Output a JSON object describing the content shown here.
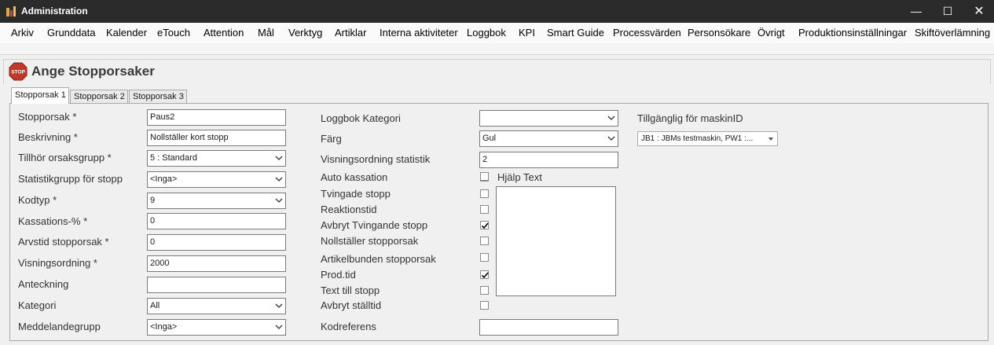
{
  "window": {
    "title": "Administration",
    "minimize": "—",
    "maximize": "☐",
    "close": "✕"
  },
  "menu": [
    "Arkiv",
    "Grunddata",
    "Kalender",
    "eTouch",
    "Attention",
    "Mål",
    "Verktyg",
    "Artiklar",
    "Interna aktiviteter",
    "Loggbok",
    "KPI",
    "Smart Guide",
    "Processvärden",
    "Personsökare",
    "Övrigt",
    "Produktionsinställningar",
    "Skiftöverlämning"
  ],
  "page": {
    "title": "Ange Stopporsaker",
    "icon": "stop-sign-icon",
    "icon_text": "STOP"
  },
  "tabs": [
    "Stopporsak 1",
    "Stopporsak 2",
    "Stopporsak 3"
  ],
  "left": {
    "stopporsak": {
      "label": "Stopporsak *",
      "value": "Paus2"
    },
    "beskrivning": {
      "label": "Beskrivning *",
      "value": "Nollställer kort stopp"
    },
    "orsaksgrupp": {
      "label": "Tillhör orsaksgrupp *",
      "value": "5 : Standard"
    },
    "statistikgrupp": {
      "label": "Statistikgrupp för stopp",
      "value": "<Inga>"
    },
    "kodtyp": {
      "label": "Kodtyp *",
      "value": "9"
    },
    "kassation": {
      "label": "Kassations-% *",
      "value": "0"
    },
    "arvstid": {
      "label": "Arvstid stopporsak *",
      "value": "0"
    },
    "visningsordning": {
      "label": "Visningsordning *",
      "value": "2000"
    },
    "anteckning": {
      "label": "Anteckning",
      "value": ""
    },
    "kategori": {
      "label": "Kategori",
      "value": "All"
    },
    "meddelandegrupp": {
      "label": "Meddelandegrupp",
      "value": "<Inga>"
    }
  },
  "middle": {
    "loggbok_kategori": {
      "label": "Loggbok Kategori",
      "value": ""
    },
    "farg": {
      "label": "Färg",
      "value": "Gul"
    },
    "visningsordning_statistik": {
      "label": "Visningsordning statistik",
      "value": "2"
    },
    "auto_kassation": {
      "label": "Auto kassation",
      "checked": false
    },
    "tvingade_stopp": {
      "label": "Tvingade stopp",
      "checked": false
    },
    "reaktionstid": {
      "label": "Reaktionstid",
      "checked": false
    },
    "avbryt_tvingande": {
      "label": "Avbryt Tvingande stopp",
      "checked": true
    },
    "nollstaller": {
      "label": "Nollställer stopporsak",
      "checked": false
    },
    "artikelbunden": {
      "label": "Artikelbunden stopporsak",
      "checked": false
    },
    "prodtid": {
      "label": "Prod.tid",
      "checked": true
    },
    "text_till_stopp": {
      "label": "Text till stopp",
      "checked": false
    },
    "avbryt_stalltid": {
      "label": "Avbryt ställtid",
      "checked": false
    },
    "kodreferens": {
      "label": "Kodreferens",
      "value": ""
    },
    "hjalp_text": {
      "label": "Hjälp Text",
      "checked": false,
      "value": ""
    }
  },
  "right": {
    "maskin_label": "Tillgänglig för maskinID",
    "maskin_value": "JB1 : JBMs testmaskin, PW1 :..."
  },
  "colors": {
    "titlebar": "#2b2b2b",
    "stop_icon": "#c0392b"
  }
}
